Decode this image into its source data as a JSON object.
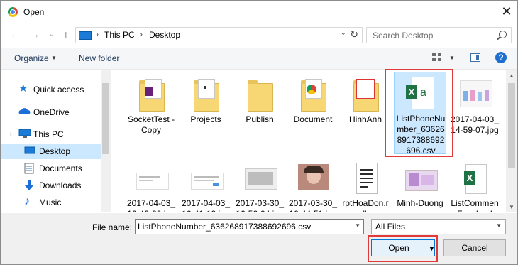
{
  "window": {
    "title": "Open",
    "close_glyph": "✕"
  },
  "nav": {
    "back_glyph": "←",
    "forward_glyph": "→",
    "recent_glyph": "⌄",
    "up_glyph": "↑",
    "address": [
      "This PC",
      "Desktop"
    ],
    "address_sep": "›",
    "refresh_glyph": "↻",
    "dropdown_glyph": "⌄",
    "search_placeholder": "Search Desktop"
  },
  "toolbar": {
    "organize_label": "Organize",
    "new_folder_label": "New folder",
    "dropdown_glyph": "▼",
    "help_glyph": "?"
  },
  "sidebar": {
    "items": [
      {
        "label": "Quick access",
        "icon": "star-icon"
      },
      {
        "label": "OneDrive",
        "icon": "cloud-icon"
      },
      {
        "label": "This PC",
        "icon": "computer-icon"
      },
      {
        "label": "Desktop",
        "icon": "desktop-icon",
        "selected": true
      },
      {
        "label": "Documents",
        "icon": "documents-icon"
      },
      {
        "label": "Downloads",
        "icon": "downloads-icon"
      },
      {
        "label": "Music",
        "icon": "music-icon"
      }
    ],
    "expand_glyph": "›"
  },
  "files": {
    "row1": [
      {
        "name": "SocketTest - Copy",
        "icon": "folder-icon"
      },
      {
        "name": "Projects",
        "icon": "folder-icon"
      },
      {
        "name": "Publish",
        "icon": "folder-icon"
      },
      {
        "name": "Document",
        "icon": "folder-icon"
      },
      {
        "name": "HinhAnh",
        "icon": "folder-icon"
      },
      {
        "name": "ListPhoneNumber_636268917388692696.csv",
        "icon": "excel-csv-icon",
        "selected": true
      },
      {
        "name": "2017-04-03_14-59-07.jpg",
        "icon": "image-icon"
      }
    ],
    "row2": [
      {
        "name": "2017-04-03_10-42-20.jpg",
        "icon": "image-icon"
      },
      {
        "name": "2017-04-03_10-41-19.jpg",
        "icon": "image-icon"
      },
      {
        "name": "2017-03-30_16-56-04.jpg",
        "icon": "image-icon"
      },
      {
        "name": "2017-03-30_16-44-51.jpg",
        "icon": "image-icon"
      },
      {
        "name": "rptHoaDon.rdlc",
        "icon": "report-icon"
      },
      {
        "name": "Minh-Duong camay",
        "icon": "image-icon"
      },
      {
        "name": "ListCommentFacebook",
        "icon": "excel-icon"
      }
    ]
  },
  "bottom": {
    "file_name_label": "File name:",
    "file_name_value": "ListPhoneNumber_636268917388692696.csv",
    "file_type_value": "All Files",
    "open_label": "Open",
    "cancel_label": "Cancel",
    "dropdown_glyph": "▼"
  },
  "colors": {
    "selection": "#cce8ff",
    "highlight_box": "#e03a3a",
    "accent": "#0078d7"
  }
}
